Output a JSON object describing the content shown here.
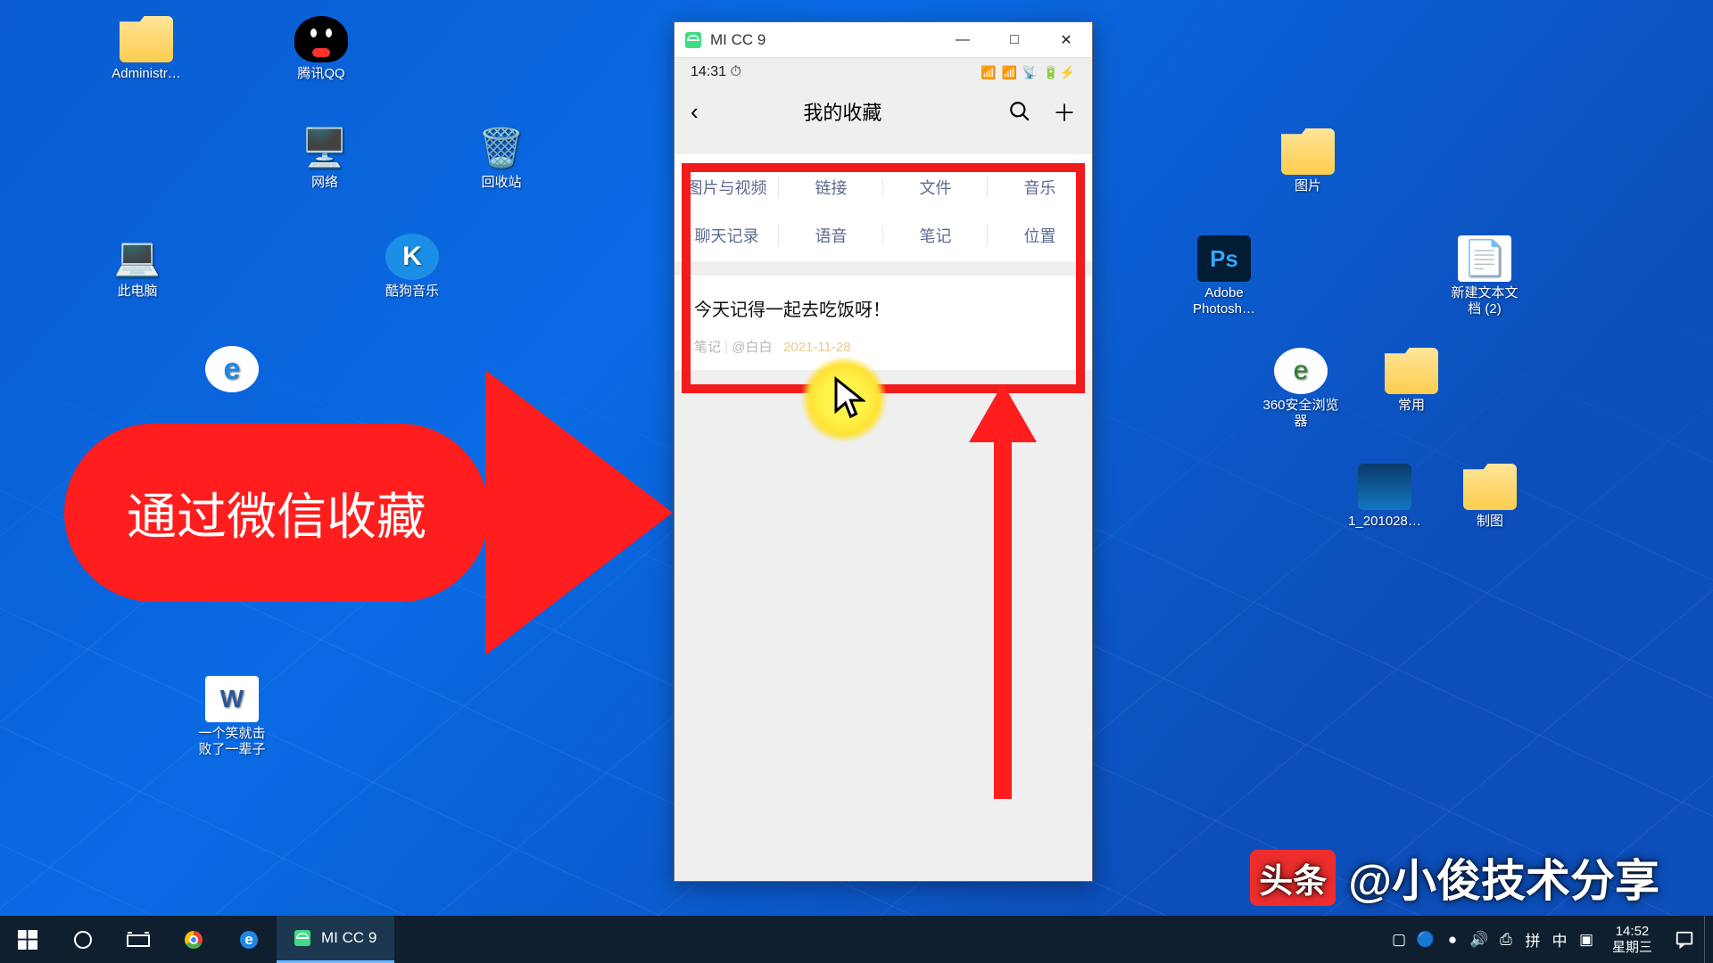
{
  "desktop_icons": {
    "admin": "Administr…",
    "qq": "腾讯QQ",
    "network": "网络",
    "recycle": "回收站",
    "thispc": "此电脑",
    "kugou": "酷狗音乐",
    "ie": "",
    "doc1": "一个笑就击\n败了一辈子",
    "pics": "图片",
    "ps": "Adobe\nPhotosh…",
    "txt": "新建文本文\n档 (2)",
    "browser360": "360安全浏览\n器",
    "common": "常用",
    "img1": "1_201028…",
    "draw": "制图"
  },
  "emulator": {
    "title": "MI CC 9"
  },
  "winbtns": {
    "min": "—",
    "max": "□",
    "close": "✕"
  },
  "phone": {
    "time": "14:31 ⏱",
    "signal": "📶 📶 📡 🔋⚡",
    "page_title": "我的收藏",
    "cats1": [
      "图片与视频",
      "链接",
      "文件",
      "音乐"
    ],
    "cats2": [
      "聊天记录",
      "语音",
      "笔记",
      "位置"
    ],
    "note_text": "今天记得一起去吃饭呀！",
    "note_type": "笔记",
    "note_from": "@白白",
    "note_date": "2021-11-28"
  },
  "callout": "通过微信收藏",
  "watermark": {
    "logo": "头条",
    "text": "@小俊技术分享"
  },
  "taskbar": {
    "active_app": "MI CC 9",
    "tray": [
      "▢",
      "🔵",
      "●",
      "🔊",
      "⎙",
      "拼",
      "中",
      "▣"
    ],
    "time": "14:52",
    "date": "星期三"
  }
}
